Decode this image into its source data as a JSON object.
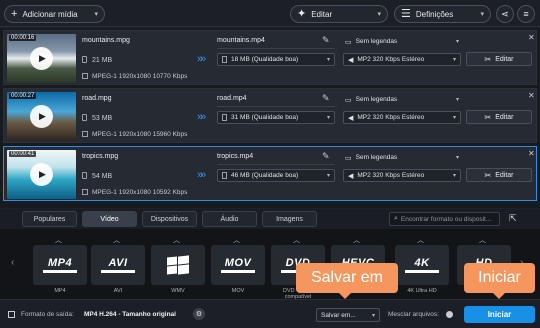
{
  "toolbar": {
    "add_media": "Adicionar mídia",
    "edit": "Editar",
    "settings": "Definições",
    "icons": {
      "add": "plus-icon",
      "edit": "wand-icon",
      "settings": "sliders-icon",
      "share": "share-icon",
      "menu": "hamburger-icon"
    }
  },
  "files": [
    {
      "duration": "00:00:16",
      "name": "mountains.mpg",
      "size": "21 MB",
      "info": "MPEG-1 1920x1080 10770 Kbps",
      "output_name": "mountains.mp4",
      "output_size": "18 MB (Qualidade boa)",
      "subtitles": "Sem legendas",
      "audio": "MP2 320 Kbps Estéreo",
      "edit": "Editar",
      "active": false
    },
    {
      "duration": "00:00:27",
      "name": "road.mpg",
      "size": "53 MB",
      "info": "MPEG-1 1920x1080 15960 Kbps",
      "output_name": "road.mp4",
      "output_size": "31 MB (Qualidade boa)",
      "subtitles": "Sem legendas",
      "audio": "MP2 320 Kbps Estéreo",
      "edit": "Editar",
      "active": false
    },
    {
      "duration": "00:00:41",
      "name": "tropics.mpg",
      "size": "54 MB",
      "info": "MPEG-1 1920x1080 10592 Kbps",
      "output_name": "tropics.mp4",
      "output_size": "46 MB (Qualidade boa)",
      "subtitles": "Sem legendas",
      "audio": "MP2 320 Kbps Estéreo",
      "edit": "Editar",
      "active": true
    }
  ],
  "tabs": [
    "Populares",
    "Vídeo",
    "Dispositivos",
    "Áudio",
    "Imagens"
  ],
  "active_tab": "Vídeo",
  "search_placeholder": "Encontrar formato ou disposit...",
  "formats": [
    {
      "logo": "MP4",
      "label": "MP4"
    },
    {
      "logo": "AVI",
      "label": "AVI"
    },
    {
      "logo": "",
      "label": "WMV",
      "icon": "windows-icon"
    },
    {
      "logo": "MOV",
      "label": "MOV"
    },
    {
      "logo": "DVD",
      "label": "DVD - vídeo compatível"
    },
    {
      "logo": "HEVC",
      "label": "H.265"
    },
    {
      "logo": "4K",
      "label": "4K Ultra HD"
    },
    {
      "logo": "HD",
      "label": "Vídeo HD"
    }
  ],
  "output": {
    "label": "Formato de saída:",
    "value": "MP4 H.264 - Tamanho original",
    "save_to": "Salvar em...",
    "merge": "Mesclar arquivos:",
    "start": "Iniciar"
  },
  "callouts": {
    "save": "Salvar em",
    "start": "Iniciar"
  },
  "colors": {
    "accent": "#1790e5",
    "callout": "#f5965e",
    "active_border": "#2d8fe6"
  }
}
